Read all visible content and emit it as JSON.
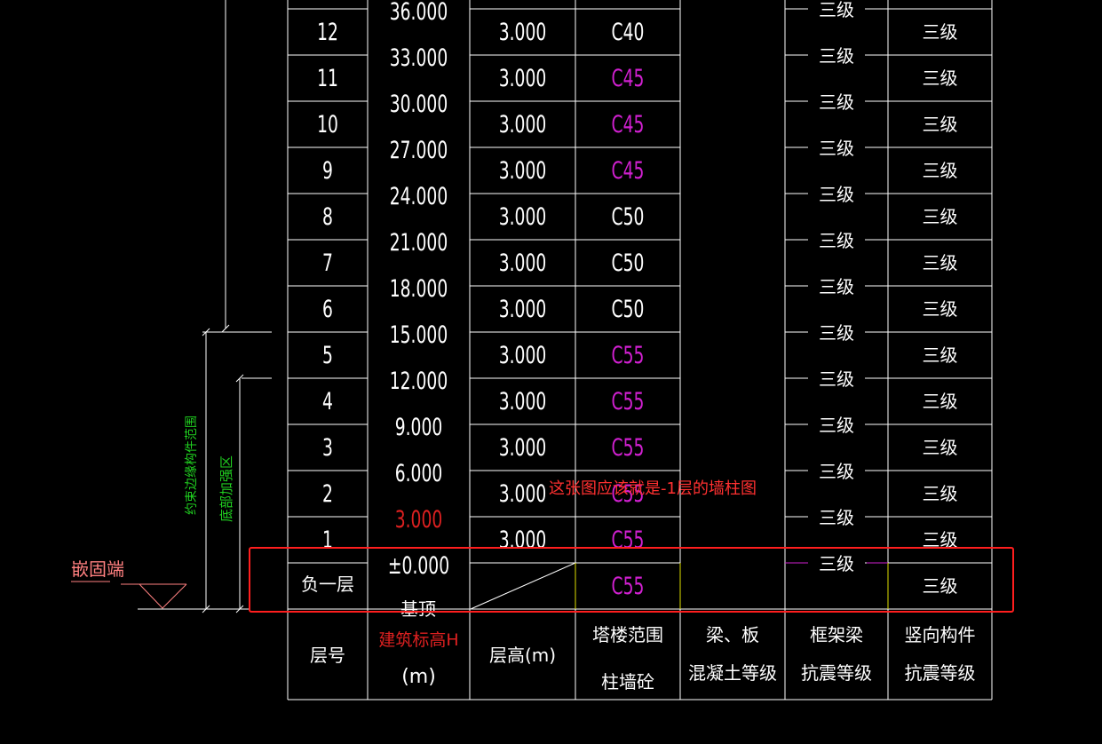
{
  "colors": {
    "line": "#ffffff",
    "text": "#ffffff",
    "magenta": "#d020d0",
    "red": "#dd2020",
    "green": "#20d020",
    "pink": "#ff8080",
    "yellow": "#e0e000",
    "annotation": "#ff3030",
    "highlight": "#ff1e1e"
  },
  "table": {
    "rows": [
      {
        "floor": "12",
        "elev": "36.000",
        "height": "3.000",
        "concrete": "C40",
        "concrete_color": "white",
        "frame_grade": "三级",
        "vertical_grade": "三级"
      },
      {
        "floor": "11",
        "elev": "33.000",
        "height": "3.000",
        "concrete": "C45",
        "concrete_color": "magenta",
        "frame_grade": "三级",
        "vertical_grade": "三级"
      },
      {
        "floor": "10",
        "elev": "30.000",
        "height": "3.000",
        "concrete": "C45",
        "concrete_color": "magenta",
        "frame_grade": "三级",
        "vertical_grade": "三级"
      },
      {
        "floor": "9",
        "elev": "27.000",
        "height": "3.000",
        "concrete": "C45",
        "concrete_color": "magenta",
        "frame_grade": "三级",
        "vertical_grade": "三级"
      },
      {
        "floor": "8",
        "elev": "24.000",
        "height": "3.000",
        "concrete": "C50",
        "concrete_color": "white",
        "frame_grade": "三级",
        "vertical_grade": "三级"
      },
      {
        "floor": "7",
        "elev": "21.000",
        "height": "3.000",
        "concrete": "C50",
        "concrete_color": "white",
        "frame_grade": "三级",
        "vertical_grade": "三级"
      },
      {
        "floor": "6",
        "elev": "18.000",
        "height": "3.000",
        "concrete": "C50",
        "concrete_color": "white",
        "frame_grade": "三级",
        "vertical_grade": "三级"
      },
      {
        "floor": "5",
        "elev": "15.000",
        "height": "3.000",
        "concrete": "C55",
        "concrete_color": "magenta",
        "frame_grade": "三级",
        "vertical_grade": "三级"
      },
      {
        "floor": "4",
        "elev": "12.000",
        "height": "3.000",
        "concrete": "C55",
        "concrete_color": "magenta",
        "frame_grade": "三级",
        "vertical_grade": "三级"
      },
      {
        "floor": "3",
        "elev": "9.000",
        "height": "3.000",
        "concrete": "C55",
        "concrete_color": "magenta",
        "frame_grade": "三级",
        "vertical_grade": "三级"
      },
      {
        "floor": "2",
        "elev": "6.000",
        "height": "3.000",
        "concrete": "C55",
        "concrete_color": "magenta",
        "frame_grade": "三级",
        "vertical_grade": "三级"
      },
      {
        "floor": "1",
        "elev": "3.000",
        "elev_color": "red",
        "height": "3.000",
        "concrete": "C55",
        "concrete_color": "magenta",
        "frame_grade": "三级",
        "vertical_grade": "三级"
      },
      {
        "floor": "负一层",
        "elev": "±0.000",
        "height": "",
        "concrete": "C55",
        "concrete_color": "magenta",
        "frame_grade": "三级",
        "vertical_grade": "三级"
      }
    ],
    "top_elev": "",
    "base_label": "基顶",
    "headers": {
      "floor": "层号",
      "elev_line1": "建筑标高H",
      "elev_line2": "(m)",
      "height": "层高(m)",
      "tower_line1": "塔楼范围",
      "tower_line2": "柱墙砼",
      "beam_line1": "梁、板",
      "beam_line2": "混凝土等级",
      "frame_line1": "框架梁",
      "frame_line2": "抗震等级",
      "vert_line1": "竖向构件",
      "vert_line2": "抗震等级"
    }
  },
  "side_labels": {
    "constraint_edge": "约束边缘构件范围",
    "bottom_strengthen": "底部加强区",
    "embed_end": "嵌固端"
  },
  "annotation": {
    "text": "这张图应该就是-1层的墙柱图"
  }
}
